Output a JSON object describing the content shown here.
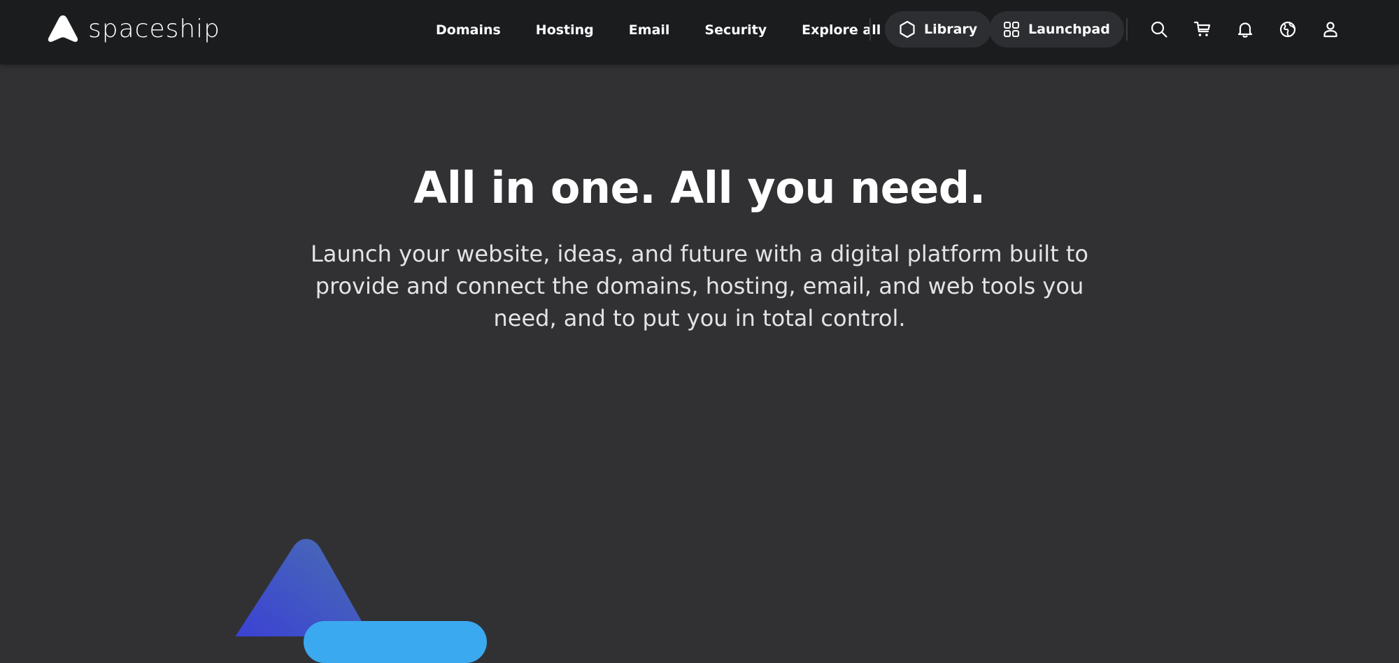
{
  "brand": {
    "name": "spaceship"
  },
  "nav": {
    "links": [
      "Domains",
      "Hosting",
      "Email",
      "Security",
      "Explore all"
    ]
  },
  "pills": {
    "library": {
      "label": "Library",
      "icon": "hexagon-icon"
    },
    "launchpad": {
      "label": "Launchpad",
      "icon": "grid-icon"
    }
  },
  "icons": [
    "search-icon",
    "cart-icon",
    "bell-icon",
    "globe-icon",
    "user-icon"
  ],
  "hero": {
    "title": "All in one. All you need.",
    "subtitle": "Launch your website, ideas, and future with a digital platform built to provide and connect the domains, hosting, email, and web tools you need, and to put you in total control."
  },
  "colors": {
    "header_bg": "#1b1c1e",
    "page_bg": "#313134",
    "pill_bg": "#2d2e31",
    "accent_blue": "#3ba9f0",
    "art_gradient_start": "#3a3fd6",
    "art_gradient_end": "#4a6fb0"
  }
}
